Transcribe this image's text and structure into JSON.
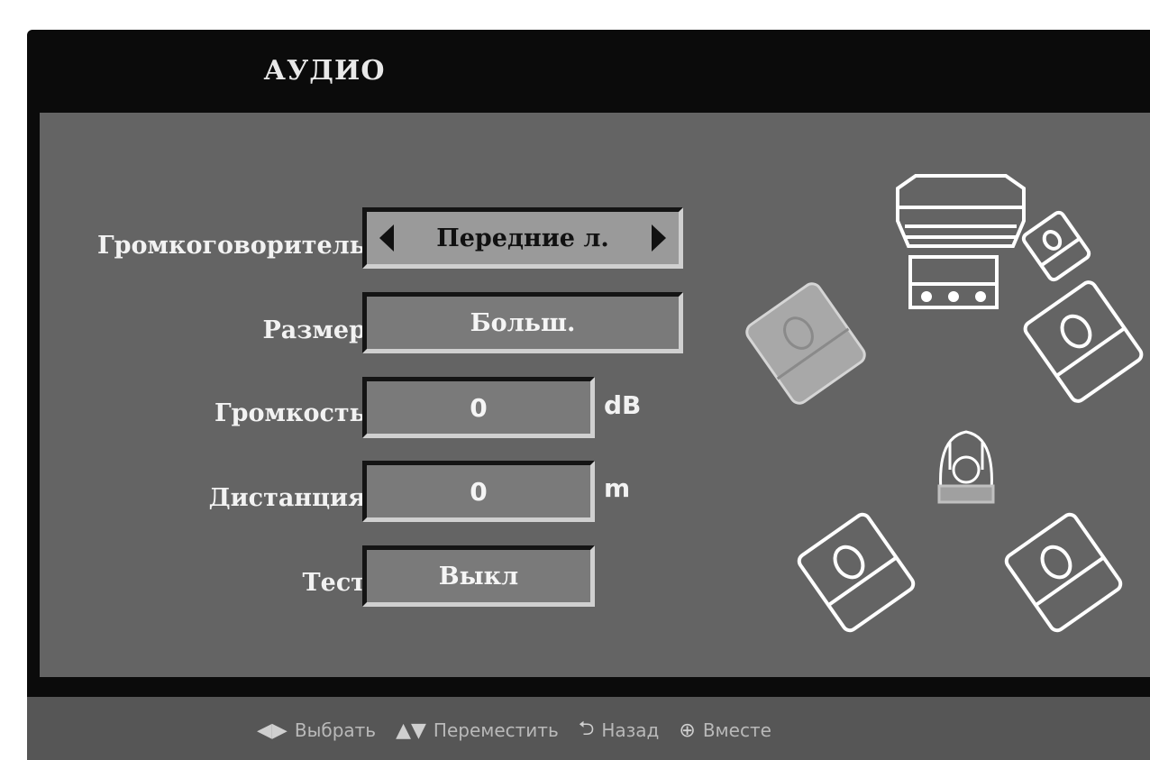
{
  "menu": {
    "title": "АУДИО"
  },
  "settings": [
    {
      "label": "Громкоговоритель",
      "value": "Передние л.",
      "unit": "",
      "selected": true
    },
    {
      "label": "Размер",
      "value": "Больш.",
      "unit": ""
    },
    {
      "label": "Громкость",
      "value": "0",
      "unit": "dB"
    },
    {
      "label": "Дистанция",
      "value": "0",
      "unit": "m"
    },
    {
      "label": "Тест",
      "value": "Выкл",
      "unit": ""
    }
  ],
  "footer_hints": [
    {
      "icon": "left-right-icon",
      "text": "Выбрать"
    },
    {
      "icon": "up-down-icon",
      "text": "Переместить"
    },
    {
      "icon": "return-icon",
      "text": "Назад"
    },
    {
      "icon": "setup-icon",
      "text": "Вместе"
    }
  ],
  "speaker_layout": {
    "active_speaker": "front-left",
    "speakers": [
      "center-speaker",
      "subwoofer",
      "front-left-speaker",
      "front-right-speaker",
      "rear-left-speaker",
      "rear-right-speaker",
      "listener"
    ]
  },
  "colors": {
    "background": "#0b0b0b",
    "panel": "#646464",
    "selected_field": "#9a9a9a",
    "text": "#f2f2f2"
  }
}
